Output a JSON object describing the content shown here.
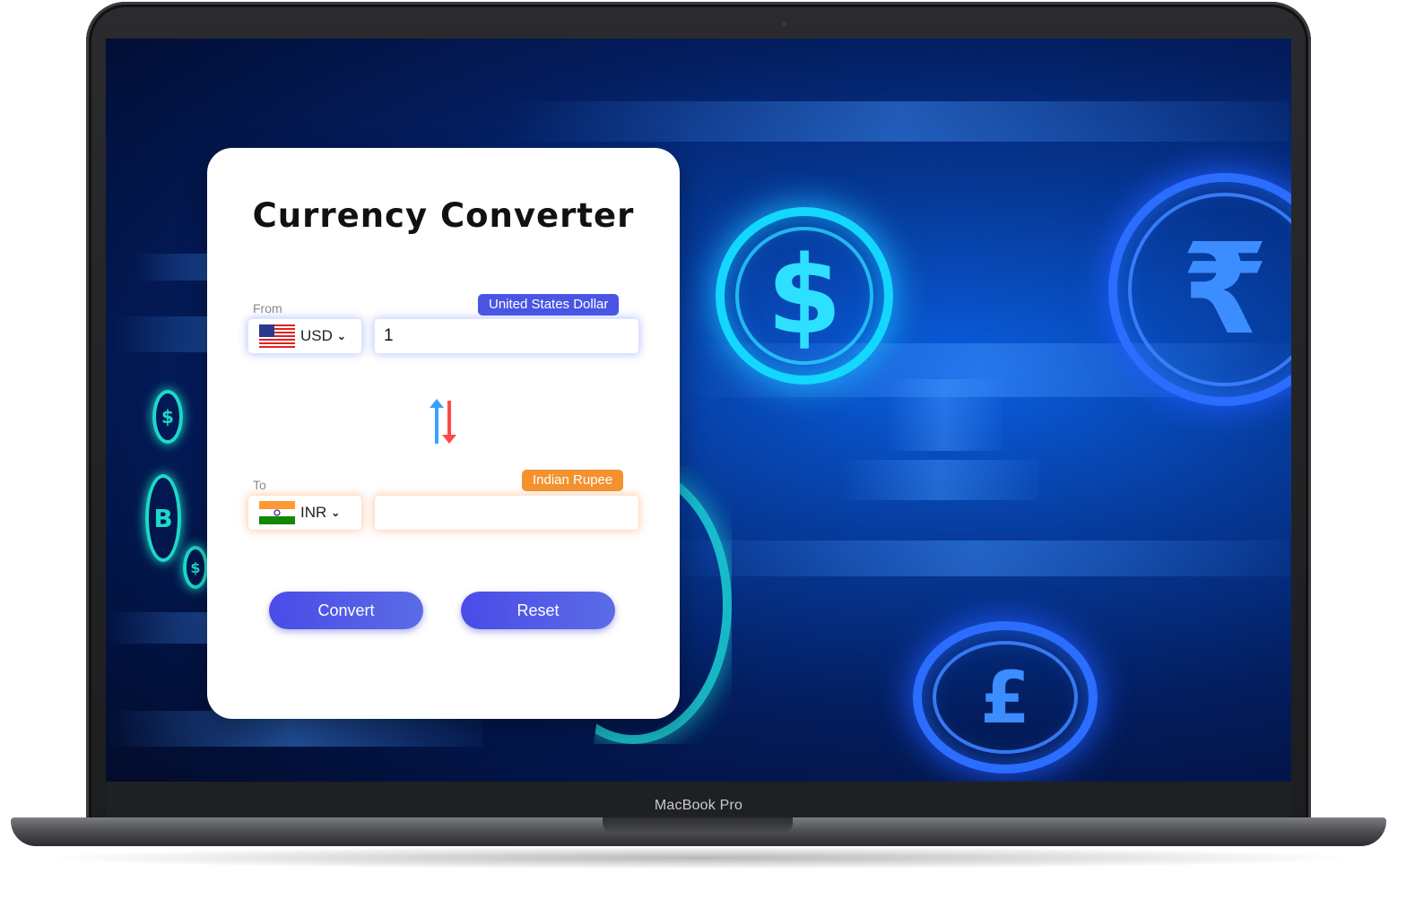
{
  "device": {
    "brand_label": "MacBook Pro"
  },
  "app": {
    "title": "Currency Converter",
    "from": {
      "label": "From",
      "currency_name": "United States Dollar",
      "currency_code": "USD",
      "flag_icon": "us-flag-icon",
      "amount": "1"
    },
    "to": {
      "label": "To",
      "currency_name": "Indian Rupee",
      "currency_code": "INR",
      "flag_icon": "india-flag-icon",
      "amount": ""
    },
    "swap_icon": "swap-arrows-icon",
    "buttons": {
      "convert": "Convert",
      "reset": "Reset"
    }
  },
  "background": {
    "coins": [
      "$",
      "₹",
      "£",
      "$",
      "B",
      "$"
    ]
  },
  "colors": {
    "from_badge": "#4a55e4",
    "to_badge": "#f3922f",
    "button": "#4b4be8",
    "swap_up": "#3aa0ff",
    "swap_down": "#ff4a4a"
  }
}
